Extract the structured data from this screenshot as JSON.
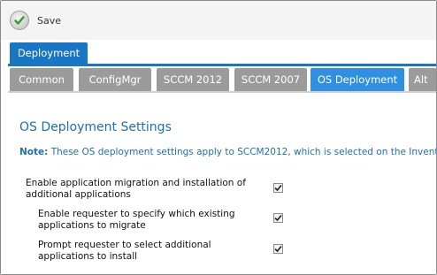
{
  "toolbar": {
    "save_label": "Save",
    "save_icon": "checkmark-circle-icon"
  },
  "primary_tab": {
    "label": "Deployment"
  },
  "tabs": [
    {
      "label": "Common",
      "active": false
    },
    {
      "label": "ConfigMgr",
      "active": false
    },
    {
      "label": "SCCM 2012",
      "active": false
    },
    {
      "label": "SCCM 2007",
      "active": false
    },
    {
      "label": "OS Deployment",
      "active": true
    },
    {
      "label": "Alt",
      "active": false
    }
  ],
  "section": {
    "title": "OS Deployment Settings",
    "note_label": "Note:",
    "note_text": "These OS deployment settings apply to SCCM2012, which is selected on the Inventor",
    "options": [
      {
        "line1": "Enable application migration and installation of",
        "line2": "additional applications",
        "checked": true
      },
      {
        "line1": "Enable requester to specify which existing",
        "line2": "applications to migrate",
        "checked": true
      },
      {
        "line1": "Prompt requester to select additional",
        "line2": "applications to install",
        "checked": true
      }
    ]
  },
  "colors": {
    "accent": "#1976c5",
    "active_tab": "#2f8fe0",
    "inactive_tab": "#9b9b9b",
    "title_text": "#1c6fb8"
  }
}
